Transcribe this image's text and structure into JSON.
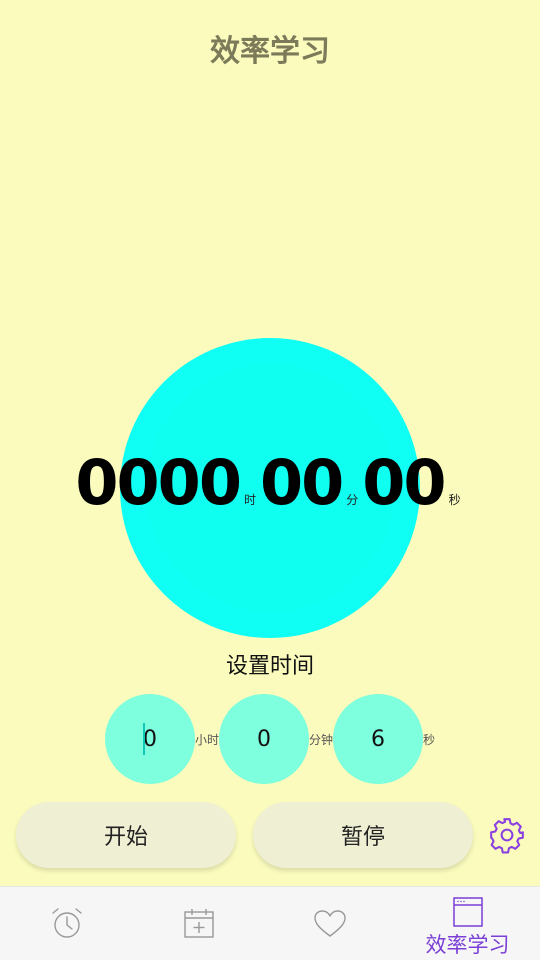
{
  "header": {
    "title": "效率学习"
  },
  "timer": {
    "hours": "0000",
    "hours_unit": "时",
    "minutes": "00",
    "minutes_unit": "分",
    "seconds": "00",
    "seconds_unit": "秒"
  },
  "set_time": {
    "label": "设置时间",
    "hours_value": "0",
    "hours_unit": "小时",
    "minutes_value": "0",
    "minutes_unit": "分钟",
    "seconds_value": "6",
    "seconds_unit": "秒"
  },
  "buttons": {
    "start": "开始",
    "pause": "暂停"
  },
  "bottom_nav": {
    "items": [
      {
        "icon": "alarm-clock-icon"
      },
      {
        "icon": "calendar-add-icon"
      },
      {
        "icon": "heart-icon"
      },
      {
        "icon": "window-icon",
        "label": "效率学习",
        "active": true
      }
    ]
  },
  "colors": {
    "background": "#fafbbd",
    "timer_circle": "#10fff4",
    "input_bubble": "#7effde",
    "button": "#efefd3",
    "accent": "#7a3fd6"
  }
}
